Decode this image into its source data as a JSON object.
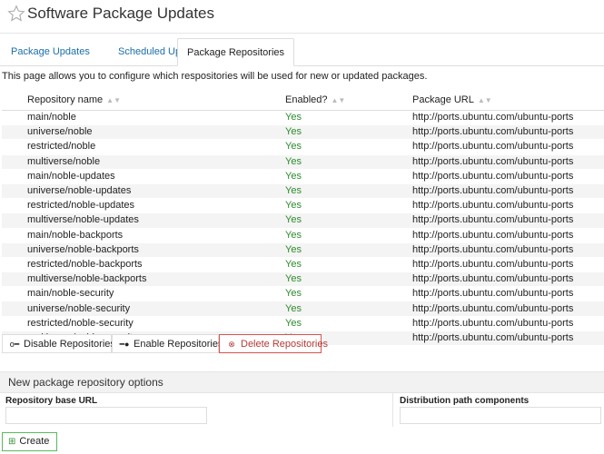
{
  "header": {
    "title": "Software Package Updates",
    "star_icon": "star-icon"
  },
  "tabs": [
    {
      "label": "Package Updates",
      "active": false
    },
    {
      "label": "Scheduled Upgrades",
      "active": false
    },
    {
      "label": "Package Repositories",
      "active": true
    }
  ],
  "description": "This page allows you to configure which respositories will be used for new or updated packages.",
  "table": {
    "columns": [
      "Repository name",
      "Enabled?",
      "Package URL"
    ],
    "rows": [
      {
        "name": "main/noble",
        "enabled": "Yes",
        "url": "http://ports.ubuntu.com/ubuntu-ports"
      },
      {
        "name": "universe/noble",
        "enabled": "Yes",
        "url": "http://ports.ubuntu.com/ubuntu-ports"
      },
      {
        "name": "restricted/noble",
        "enabled": "Yes",
        "url": "http://ports.ubuntu.com/ubuntu-ports"
      },
      {
        "name": "multiverse/noble",
        "enabled": "Yes",
        "url": "http://ports.ubuntu.com/ubuntu-ports"
      },
      {
        "name": "main/noble-updates",
        "enabled": "Yes",
        "url": "http://ports.ubuntu.com/ubuntu-ports"
      },
      {
        "name": "universe/noble-updates",
        "enabled": "Yes",
        "url": "http://ports.ubuntu.com/ubuntu-ports"
      },
      {
        "name": "restricted/noble-updates",
        "enabled": "Yes",
        "url": "http://ports.ubuntu.com/ubuntu-ports"
      },
      {
        "name": "multiverse/noble-updates",
        "enabled": "Yes",
        "url": "http://ports.ubuntu.com/ubuntu-ports"
      },
      {
        "name": "main/noble-backports",
        "enabled": "Yes",
        "url": "http://ports.ubuntu.com/ubuntu-ports"
      },
      {
        "name": "universe/noble-backports",
        "enabled": "Yes",
        "url": "http://ports.ubuntu.com/ubuntu-ports"
      },
      {
        "name": "restricted/noble-backports",
        "enabled": "Yes",
        "url": "http://ports.ubuntu.com/ubuntu-ports"
      },
      {
        "name": "multiverse/noble-backports",
        "enabled": "Yes",
        "url": "http://ports.ubuntu.com/ubuntu-ports"
      },
      {
        "name": "main/noble-security",
        "enabled": "Yes",
        "url": "http://ports.ubuntu.com/ubuntu-ports"
      },
      {
        "name": "universe/noble-security",
        "enabled": "Yes",
        "url": "http://ports.ubuntu.com/ubuntu-ports"
      },
      {
        "name": "restricted/noble-security",
        "enabled": "Yes",
        "url": "http://ports.ubuntu.com/ubuntu-ports"
      },
      {
        "name": "multiverse/noble-security",
        "enabled": "Yes",
        "url": "http://ports.ubuntu.com/ubuntu-ports"
      }
    ]
  },
  "buttons": {
    "disable": {
      "label": "Disable Repositories",
      "icon": "toggle-off-icon"
    },
    "enable": {
      "label": "Enable Repositories",
      "icon": "toggle-on-icon"
    },
    "delete": {
      "label": "Delete Repositories",
      "icon": "times-circle-icon"
    }
  },
  "new_repo": {
    "section_title": "New package repository options",
    "base_url_label": "Repository base URL",
    "base_url_value": "",
    "dist_path_label": "Distribution path components",
    "dist_path_value": ""
  },
  "create": {
    "label": "Create",
    "icon": "plus-square-icon"
  },
  "colors": {
    "link": "#1a6ea8",
    "enabled_yes": "#2e8b2e",
    "danger": "#d9534f",
    "success": "#5cb85c"
  }
}
